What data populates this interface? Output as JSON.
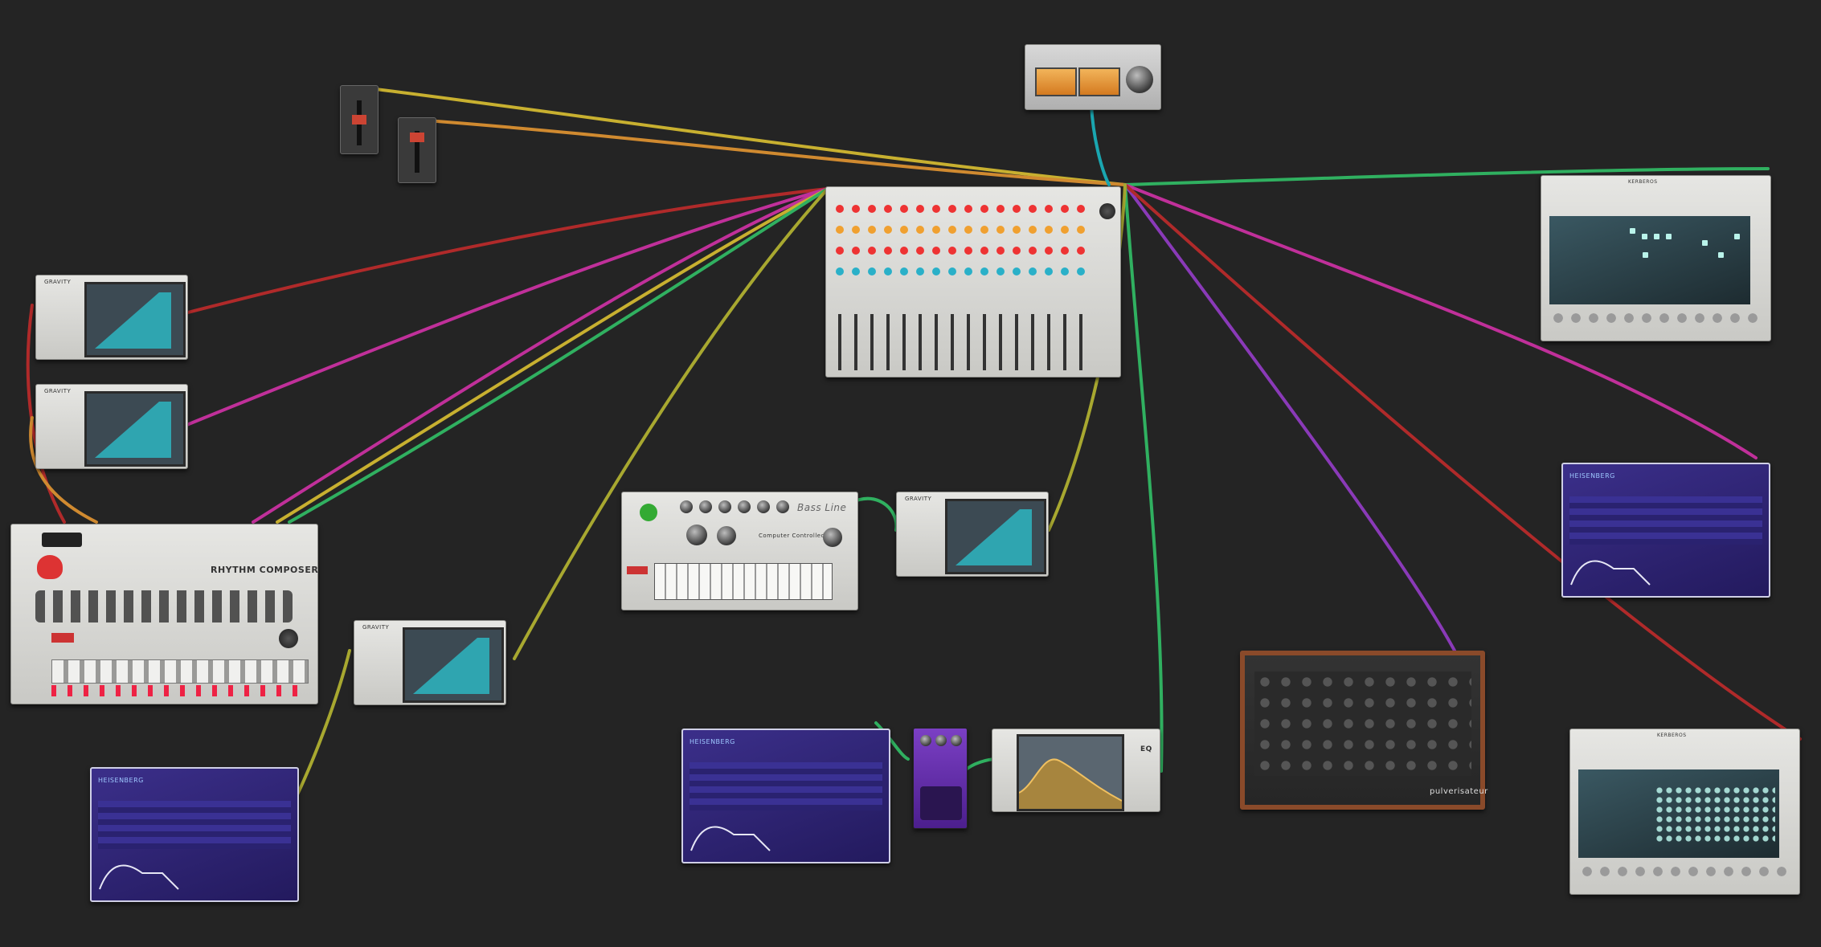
{
  "app": {
    "canvas_bg": "#242424"
  },
  "colors": {
    "cable_red": "#b02a2a",
    "cable_magenta": "#c0309a",
    "cable_green": "#30b060",
    "cable_yellow": "#c8b030",
    "cable_orange": "#d08a30",
    "cable_olive": "#a8a830",
    "cable_purple": "#8a3ab8",
    "cable_teal": "#1aa6b0",
    "scope_fill": "#2fa5b0",
    "purple_panel": "#2d2270"
  },
  "devices": {
    "rhythm_composer": {
      "title": "RHYTHM COMPOSER"
    },
    "bass_line": {
      "title": "Bass Line",
      "sub": "Computer Controlled"
    },
    "heisenberg_1": {
      "title": "HEISENBERG"
    },
    "heisenberg_2": {
      "title": "HEISENBERG"
    },
    "heisenberg_3": {
      "title": "HEISENBERG"
    },
    "pulverisateur": {
      "title": "pulverisateur"
    },
    "eq": {
      "title": "EQ"
    },
    "kerberos_1": {
      "title": "KERBEROS"
    },
    "kerberos_2": {
      "title": "KERBEROS"
    },
    "gravity_1": {
      "title": "GRAVITY"
    },
    "gravity_2": {
      "title": "GRAVITY"
    },
    "gravity_3": {
      "title": "GRAVITY"
    },
    "gravity_4": {
      "title": "GRAVITY"
    }
  }
}
